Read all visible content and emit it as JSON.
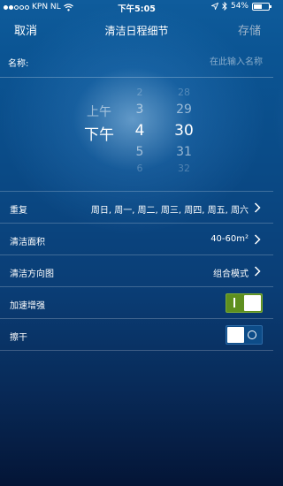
{
  "status_bar": {
    "carrier": "KPN NL",
    "time": "下午5:05",
    "battery": "54%",
    "battery_level": 0.54
  },
  "nav": {
    "cancel": "取消",
    "title": "清洁日程细节",
    "save": "存储"
  },
  "name": {
    "label": "名称:",
    "placeholder": "在此输入名称",
    "value": ""
  },
  "picker": {
    "ampm": {
      "above": "上午",
      "selected": "下午"
    },
    "hours": [
      "2",
      "3",
      "4",
      "5",
      "6"
    ],
    "minutes": [
      "28",
      "29",
      "30",
      "31",
      "32"
    ]
  },
  "settings": {
    "repeat": {
      "label": "重复",
      "value": "周日, 周一, 周二, 周三, 周四, 周五, 周六"
    },
    "area": {
      "label": "清洁面积",
      "value": "40-60m²"
    },
    "direction": {
      "label": "清洁方向图",
      "value": "组合模式"
    },
    "boost": {
      "label": "加速增强",
      "on": true
    },
    "dry": {
      "label": "擦干",
      "on": false
    }
  },
  "colors": {
    "background_top": "#0f5c9c",
    "background_bottom": "#041536",
    "toggle_on": "#5e8f1f"
  }
}
